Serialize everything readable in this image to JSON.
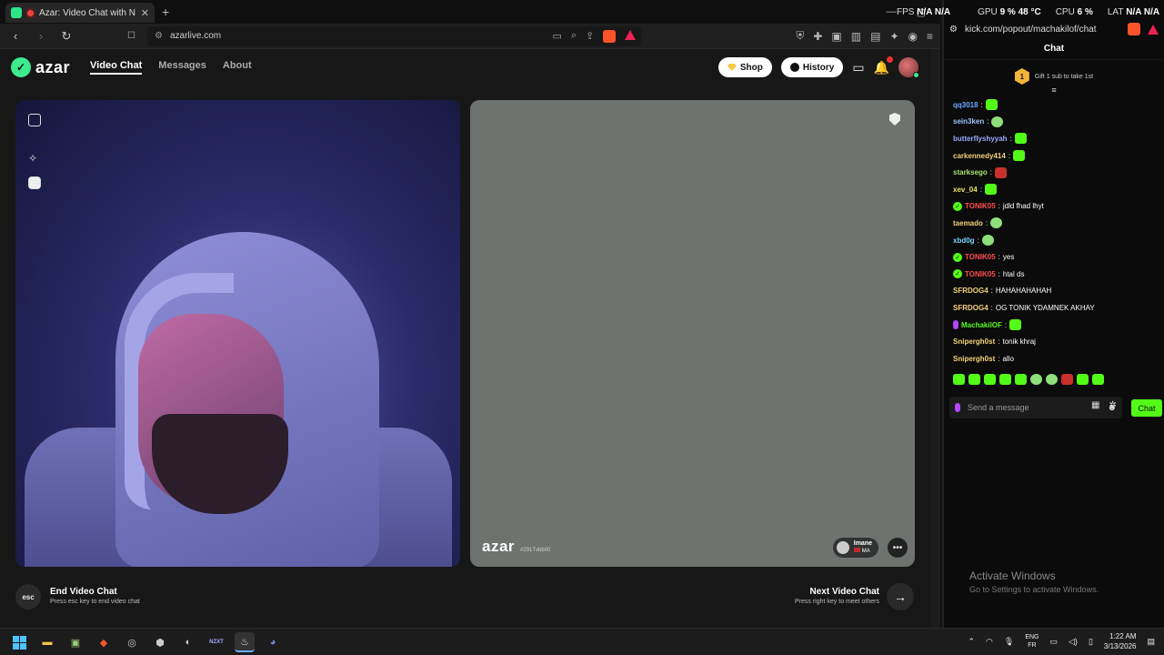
{
  "browser": {
    "tab_title": "Azar: Video Chat with New Pe",
    "url": "azarlive.com",
    "new_tab": "+"
  },
  "site": {
    "logo": "azar",
    "nav": [
      "Video Chat",
      "Messages",
      "About"
    ],
    "shop_label": "Shop",
    "history_label": "History"
  },
  "peer": {
    "logo": "azar",
    "tag": "#291Tvbb00",
    "name": "Imane",
    "country": "MA",
    "accent": "#3dea8e"
  },
  "actions": {
    "esc_label": "esc",
    "end_title": "End Video Chat",
    "end_sub": "Press esc key to end video chat",
    "next_title": "Next Video Chat",
    "next_sub": "Press right key to meet others"
  },
  "overlay": {
    "fps_label": "FPS",
    "fps_value": "N/A",
    "fps_value2": "N/A",
    "gpu_label": "GPU",
    "gpu_value": "9 %",
    "gpu_temp": "48 °C",
    "cpu_label": "CPU",
    "cpu_value": "6 %",
    "lat_label": "LAT",
    "lat_value": "N/A",
    "lat_value2": "N/A"
  },
  "kick": {
    "url": "kick.com/popout/machakilof/chat",
    "header": "Chat",
    "gift_count": "1",
    "gift_text": "Gift 1 sub to take 1st",
    "input_placeholder": "Send a message",
    "send_label": "Chat",
    "messages": [
      {
        "user": "qq3018",
        "color": "#6aa5ff",
        "text": "",
        "emote": "green"
      },
      {
        "user": "sein3ken",
        "color": "#9cc5ff",
        "text": "",
        "emote": "round"
      },
      {
        "user": "butterflyshyyah",
        "color": "#9aa8ff",
        "text": "",
        "emote": "green"
      },
      {
        "user": "carkennedy414",
        "color": "#f5d27a",
        "text": "",
        "emote": "green"
      },
      {
        "user": "starksego",
        "color": "#a8e26a",
        "text": "",
        "emote": "red"
      },
      {
        "user": "xev_04",
        "color": "#e8e46a",
        "text": "",
        "emote": "green"
      },
      {
        "user": "TONIK05",
        "color": "#ff4d4d",
        "text": "jdld fhad lhyt",
        "emote": "",
        "badge": "verified"
      },
      {
        "user": "taemado",
        "color": "#f5d27a",
        "text": "",
        "emote": "round"
      },
      {
        "user": "xbd0g",
        "color": "#7ad3ff",
        "text": "",
        "emote": "round"
      },
      {
        "user": "TONIK05",
        "color": "#ff4d4d",
        "text": "yes",
        "emote": "",
        "badge": "verified"
      },
      {
        "user": "TONIK05",
        "color": "#ff4d4d",
        "text": "htal ds",
        "emote": "",
        "badge": "verified"
      },
      {
        "user": "SFRDOG4",
        "color": "#f5d27a",
        "text": "HAHAHAHAHAH",
        "emote": ""
      },
      {
        "user": "SFRDOG4",
        "color": "#f5d27a",
        "text": "OG TONIK YDAMNEK AKHAY",
        "emote": ""
      },
      {
        "user": "MachakilOF",
        "color": "#53fc18",
        "text": "",
        "emote": "green",
        "badge": "mod"
      },
      {
        "user": "Snipergh0st",
        "color": "#f5d27a",
        "text": "tonik khraj",
        "emote": ""
      },
      {
        "user": "Snipergh0st",
        "color": "#f5d27a",
        "text": "allo",
        "emote": ""
      }
    ],
    "emote_bar": [
      "green",
      "green",
      "green",
      "green",
      "green",
      "round",
      "round",
      "red",
      "green",
      "green"
    ]
  },
  "windows": {
    "activate_title": "Activate Windows",
    "activate_sub": "Go to Settings to activate Windows.",
    "lang_top": "ENG",
    "lang_bottom": "FR",
    "time": "1:22 AM",
    "date": "3/13/2026"
  }
}
